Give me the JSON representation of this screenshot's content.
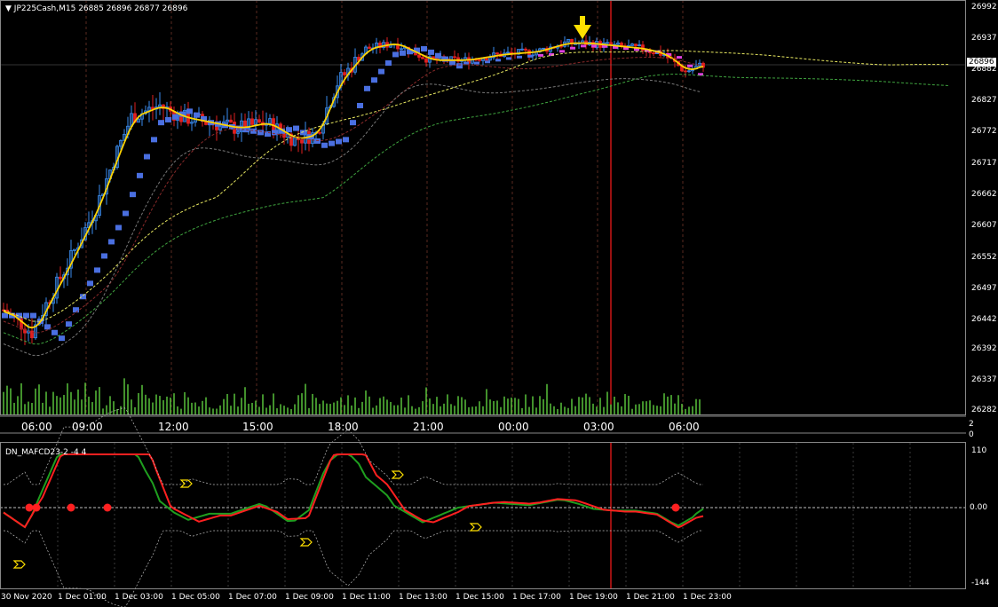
{
  "header": {
    "symbol": "JP225Cash,M15",
    "ohlc": "26885 26896 26877 26896"
  },
  "current_price": "26896",
  "price_axis": [
    "26992",
    "26937",
    "26882",
    "26827",
    "26772",
    "26717",
    "26662",
    "26607",
    "26552",
    "26497",
    "26442",
    "26392",
    "26337",
    "26282"
  ],
  "time_axis": [
    "06:00",
    "09:00",
    "12:00",
    "15:00",
    "18:00",
    "21:00",
    "00:00",
    "03:00",
    "06:00"
  ],
  "volume_axis": [
    "2",
    "0"
  ],
  "indicator": {
    "name": "DN_MAFCD23-2 -4 4",
    "axis": [
      "110",
      "0.00",
      "-144"
    ]
  },
  "date_axis": [
    "30 Nov 2020",
    "1 Dec 01:00",
    "1 Dec 03:00",
    "1 Dec 05:00",
    "1 Dec 07:00",
    "1 Dec 09:00",
    "1 Dec 11:00",
    "1 Dec 13:00",
    "1 Dec 15:00",
    "1 Dec 17:00",
    "1 Dec 19:00",
    "1 Dec 21:00",
    "1 Dec 23:00"
  ],
  "colors": {
    "bull": "#3a8df0",
    "bear": "#e02020",
    "ma_yellow": "#ffd400",
    "step_blue": "#4a6fe0",
    "grid": "#3a3a3a",
    "vline_red": "#ff1a1a",
    "volume": "#5fcf3f",
    "osc_green": "#1f9f1f",
    "osc_red": "#ff2020"
  },
  "icons": [
    "down-arrow-icon",
    "signal-arrow-icon"
  ]
}
